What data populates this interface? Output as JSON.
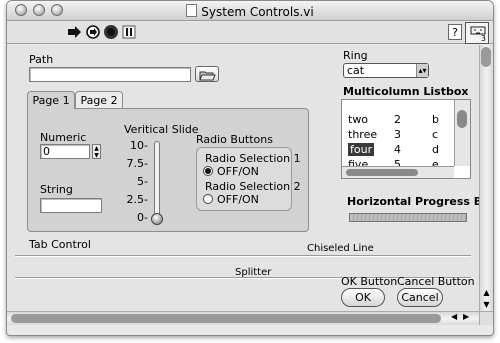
{
  "window": {
    "title": "System Controls.vi",
    "connector_pane_label": "3"
  },
  "toolbar": {
    "buttons": [
      "run-arrow-icon",
      "run-continuously-icon",
      "abort-icon",
      "pause-icon"
    ],
    "help_label": "?"
  },
  "path": {
    "label": "Path",
    "value": ""
  },
  "ring": {
    "label": "Ring",
    "value": "cat"
  },
  "tab_control": {
    "tabs": [
      "Page 1",
      "Page 2"
    ],
    "active_tab": 0,
    "label": "Tab Control"
  },
  "numeric": {
    "label": "Numeric",
    "value": "0"
  },
  "string": {
    "label": "String",
    "value": ""
  },
  "slide": {
    "label": "Veritical Slide",
    "ticks": [
      "10-",
      "7.5-",
      "5-",
      "2.5-",
      "0-"
    ],
    "value": 0
  },
  "radio_buttons": {
    "label": "Radio Buttons",
    "items": [
      {
        "label": "Radio Selection 1",
        "option": "OFF/ON",
        "selected": true
      },
      {
        "label": "Radio Selection 2",
        "option": "OFF/ON",
        "selected": false
      }
    ]
  },
  "listbox": {
    "label": "Multicolumn Listbox",
    "rows": [
      [
        "two",
        "2",
        "b"
      ],
      [
        "three",
        "3",
        "c"
      ],
      [
        "four",
        "4",
        "d"
      ],
      [
        "five",
        "5",
        "e"
      ]
    ],
    "selected_row": 2
  },
  "progress": {
    "label": "Horizontal Progress Bar",
    "fraction": 0.0
  },
  "chiseled_line_label": "Chiseled Line",
  "splitter_label": "Splitter",
  "ok": {
    "label": "OK Button",
    "button": "OK"
  },
  "cancel": {
    "label": "Cancel Button",
    "button": "Cancel"
  },
  "colors": {
    "selection": "#3a3a3a",
    "panel": "#e4e4e4",
    "tab_face": "#d2d2d2"
  }
}
